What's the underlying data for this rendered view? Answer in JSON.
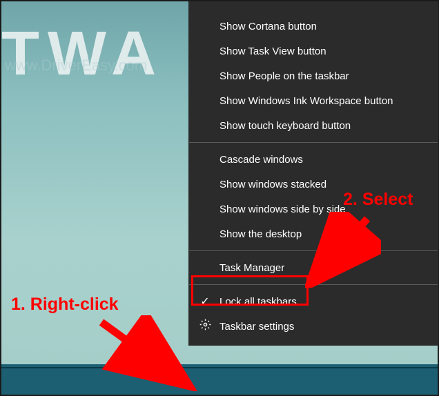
{
  "wallpaper": {
    "text": "TWA",
    "watermark": "www.DriverEasy.com"
  },
  "menu": {
    "items": {
      "cortana": "Show Cortana button",
      "taskview": "Show Task View button",
      "people": "Show People on the taskbar",
      "ink": "Show Windows Ink Workspace button",
      "touchkb": "Show touch keyboard button",
      "cascade": "Cascade windows",
      "stacked": "Show windows stacked",
      "sidebyside": "Show windows side by side",
      "desktop": "Show the desktop",
      "taskmgr": "Task Manager",
      "locktb": "Lock all taskbars",
      "tbsettings": "Taskbar settings"
    }
  },
  "annotations": {
    "step1": "1. Right-click",
    "step2": "2. Select"
  }
}
